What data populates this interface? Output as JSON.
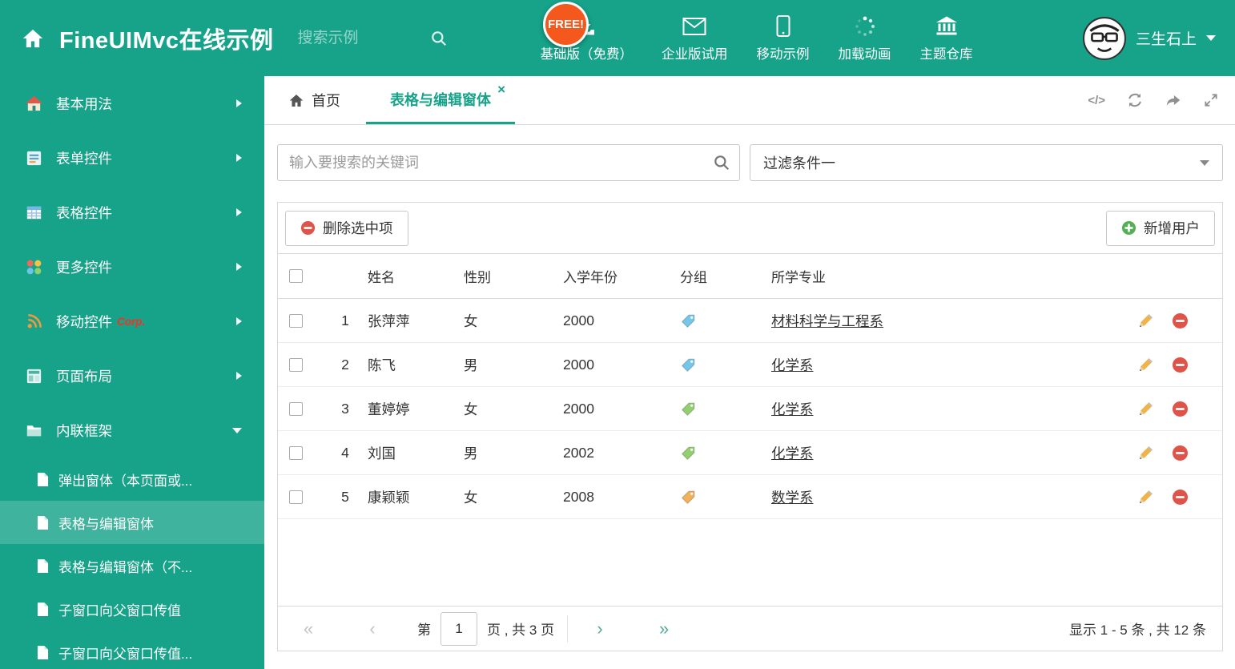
{
  "header": {
    "title": "FineUIMvc在线示例",
    "search": {
      "placeholder": "搜索示例"
    },
    "free_badge": "FREE!",
    "nav": [
      {
        "icon": "download-icon",
        "label": "基础版（免费）"
      },
      {
        "icon": "envelope-icon",
        "label": "企业版试用"
      },
      {
        "icon": "mobile-icon",
        "label": "移动示例"
      },
      {
        "icon": "spinner-icon",
        "label": "加载动画"
      },
      {
        "icon": "bank-icon",
        "label": "主题仓库"
      }
    ],
    "user": {
      "name": "三生石上"
    }
  },
  "sidebar": {
    "items": [
      {
        "label": "基本用法"
      },
      {
        "label": "表单控件"
      },
      {
        "label": "表格控件"
      },
      {
        "label": "更多控件"
      },
      {
        "label": "移动控件",
        "badge": "Corp."
      },
      {
        "label": "页面布局"
      },
      {
        "label": "内联框架"
      }
    ],
    "subitems": [
      {
        "label": "弹出窗体（本页面或..."
      },
      {
        "label": "表格与编辑窗体"
      },
      {
        "label": "表格与编辑窗体（不..."
      },
      {
        "label": "子窗口向父窗口传值"
      },
      {
        "label": "子窗口向父窗口传值..."
      }
    ]
  },
  "tabs": {
    "home": "首页",
    "active": "表格与编辑窗体"
  },
  "filter": {
    "search_placeholder": "输入要搜索的关键词",
    "dropdown_value": "过滤条件一"
  },
  "toolbar": {
    "delete_label": "删除选中项",
    "add_label": "新增用户"
  },
  "table": {
    "columns": [
      "姓名",
      "性别",
      "入学年份",
      "分组",
      "所学专业"
    ],
    "rows": [
      {
        "num": "1",
        "name": "张萍萍",
        "gender": "女",
        "year": "2000",
        "tag_color": "#74c7e8",
        "major": "材料科学与工程系"
      },
      {
        "num": "2",
        "name": "陈飞",
        "gender": "男",
        "year": "2000",
        "tag_color": "#74c7e8",
        "major": "化学系"
      },
      {
        "num": "3",
        "name": "董婷婷",
        "gender": "女",
        "year": "2000",
        "tag_color": "#93cf70",
        "major": "化学系"
      },
      {
        "num": "4",
        "name": "刘国",
        "gender": "男",
        "year": "2002",
        "tag_color": "#93cf70",
        "major": "化学系"
      },
      {
        "num": "5",
        "name": "康颖颖",
        "gender": "女",
        "year": "2008",
        "tag_color": "#f3b15a",
        "major": "数学系"
      }
    ]
  },
  "pagination": {
    "page_prefix": "第",
    "page_value": "1",
    "page_suffix": "页 , 共 3 页",
    "summary": "显示 1 - 5 条 , 共 12 条"
  },
  "icons": {
    "code": "</>",
    "close": "×",
    "first": "«",
    "prev": "‹",
    "next": "›",
    "last": "»"
  },
  "colors": {
    "theme_green": "#16a389",
    "free_badge_bg": "#f4581c",
    "delete_red": "#e05348",
    "add_green": "#55b055",
    "edit_orange": "#efb34c"
  }
}
